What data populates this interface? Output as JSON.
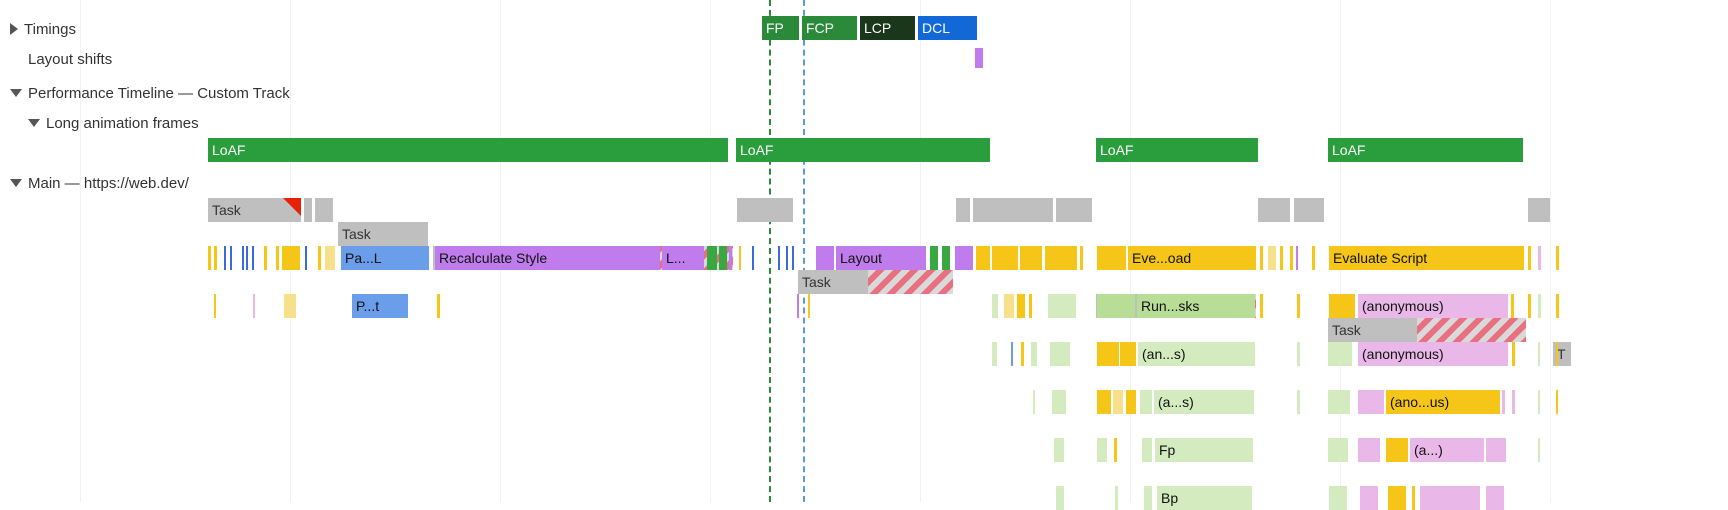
{
  "tracks": {
    "timings": {
      "label": "Timings",
      "markers": {
        "fp": "FP",
        "fcp": "FCP",
        "lcp": "LCP",
        "dcl": "DCL"
      }
    },
    "layout_shifts": {
      "label": "Layout shifts"
    },
    "perf_timeline": {
      "label": "Performance Timeline — Custom Track"
    },
    "loaf_track": {
      "label": "Long animation frames",
      "entries": [
        "LoAF",
        "LoAF",
        "LoAF",
        "LoAF"
      ]
    },
    "main": {
      "label": "Main — https://web.dev/",
      "tasks": {
        "t0": "Task",
        "t1": "Task",
        "t2": "Task",
        "t3": "Task",
        "t4": "Task",
        "t5": "Task",
        "t6": "T"
      },
      "stacks": {
        "parse": "Pa...L",
        "pt": "P...t",
        "recalc": "Recalculate Style",
        "layout_small": "L...",
        "layout": "Layout",
        "eve_load": "Eve...oad",
        "run_sks": "Run...sks",
        "an_s_1": "(an...s)",
        "a_s": "(a...s)",
        "fp": "Fp",
        "bp": "Bp",
        "eval_script": "Evaluate Script",
        "anon1": "(anonymous)",
        "anon2": "(anonymous)",
        "ano_us": "(ano...us)",
        "a_dot": "(a...)"
      }
    }
  }
}
